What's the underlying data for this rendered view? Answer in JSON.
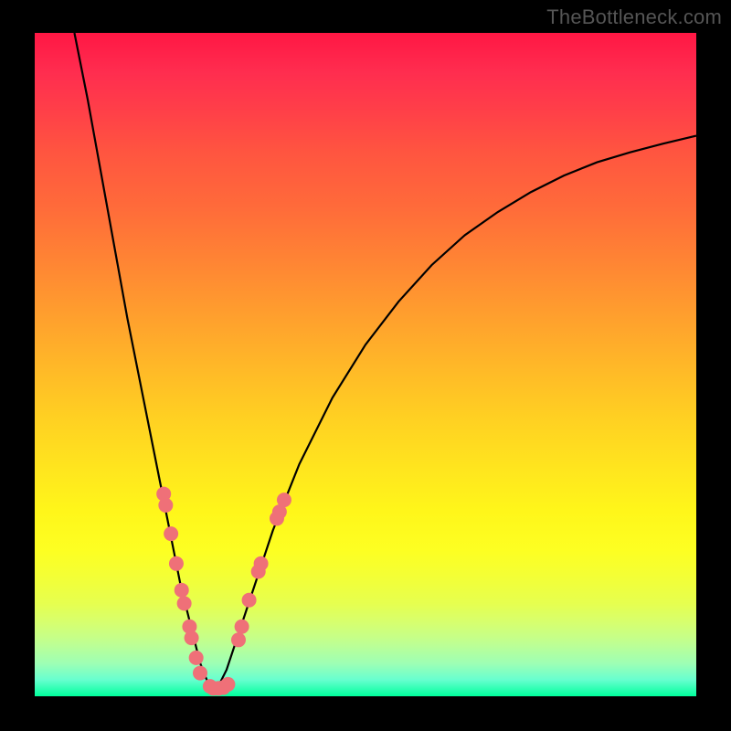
{
  "watermark": "TheBottleneck.com",
  "colors": {
    "background": "#000000",
    "gradient_top": "#ff1744",
    "gradient_bottom": "#00ff9c",
    "curve": "#000000",
    "dots": "#ef7078",
    "watermark_text": "#555555"
  },
  "chart_data": {
    "type": "line",
    "title": "",
    "xlabel": "",
    "ylabel": "",
    "xlim": [
      0,
      100
    ],
    "ylim": [
      0,
      100
    ],
    "series": [
      {
        "name": "bottleneck-curve-left",
        "x": [
          6,
          8,
          10,
          12,
          14,
          16,
          18,
          20,
          21,
          22,
          23,
          24,
          25,
          26,
          27
        ],
        "y": [
          100,
          90,
          79,
          68,
          57,
          47,
          37,
          27,
          22,
          17,
          13,
          9,
          5,
          2.5,
          1
        ]
      },
      {
        "name": "bottleneck-curve-right",
        "x": [
          27,
          28,
          29,
          30,
          32,
          34,
          36,
          40,
          45,
          50,
          55,
          60,
          65,
          70,
          75,
          80,
          85,
          90,
          95,
          100
        ],
        "y": [
          1,
          2,
          4,
          7,
          13,
          19,
          25,
          35,
          45,
          53,
          59.5,
          65,
          69.5,
          73,
          76,
          78.5,
          80.5,
          82,
          83.3,
          84.5
        ]
      }
    ],
    "dots": [
      {
        "x": 19.5,
        "y": 30.5
      },
      {
        "x": 19.8,
        "y": 28.8
      },
      {
        "x": 20.6,
        "y": 24.5
      },
      {
        "x": 21.4,
        "y": 20.0
      },
      {
        "x": 22.2,
        "y": 16.0
      },
      {
        "x": 22.6,
        "y": 14.0
      },
      {
        "x": 23.4,
        "y": 10.5
      },
      {
        "x": 23.7,
        "y": 8.8
      },
      {
        "x": 24.4,
        "y": 5.8
      },
      {
        "x": 25.0,
        "y": 3.5
      },
      {
        "x": 26.5,
        "y": 1.5
      },
      {
        "x": 27.0,
        "y": 1.2
      },
      {
        "x": 27.8,
        "y": 1.2
      },
      {
        "x": 28.5,
        "y": 1.3
      },
      {
        "x": 29.2,
        "y": 1.8
      },
      {
        "x": 30.8,
        "y": 8.5
      },
      {
        "x": 31.3,
        "y": 10.5
      },
      {
        "x": 32.4,
        "y": 14.5
      },
      {
        "x": 33.8,
        "y": 18.8
      },
      {
        "x": 34.2,
        "y": 20.0
      },
      {
        "x": 36.6,
        "y": 26.8
      },
      {
        "x": 37.0,
        "y": 27.8
      },
      {
        "x": 37.7,
        "y": 29.6
      }
    ],
    "annotations": []
  }
}
